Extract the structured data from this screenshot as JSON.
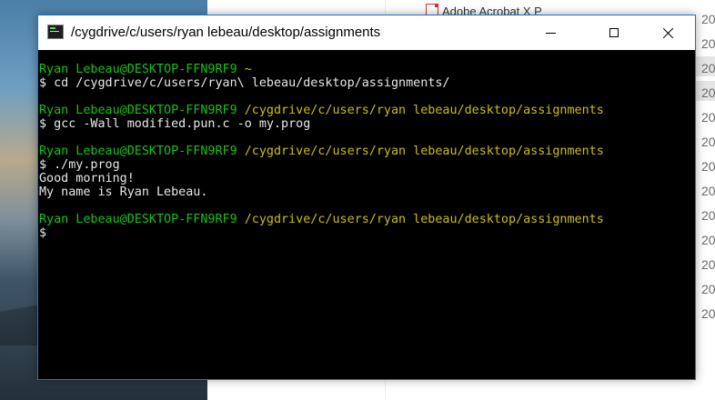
{
  "terminal": {
    "title": "/cygdrive/c/users/ryan lebeau/desktop/assignments",
    "controls": {
      "minimize_icon": "minimize-icon",
      "maximize_icon": "maximize-icon",
      "close_icon": "close-icon"
    },
    "colors": {
      "user_host": "#13c313",
      "path": "#c9c000",
      "text": "#e8e8e8",
      "background": "#000000",
      "border": "#1f72c6"
    },
    "lines": [
      {
        "user_host": "Ryan Lebeau@DESKTOP-FFN9RF9",
        "path": "~"
      },
      {
        "cmd": "$ cd /cygdrive/c/users/ryan\\ lebeau/desktop/assignments/"
      },
      {
        "blank": true
      },
      {
        "user_host": "Ryan Lebeau@DESKTOP-FFN9RF9",
        "path": "/cygdrive/c/users/ryan lebeau/desktop/assignments"
      },
      {
        "cmd": "$ gcc -Wall modified.pun.c -o my.prog"
      },
      {
        "blank": true
      },
      {
        "user_host": "Ryan Lebeau@DESKTOP-FFN9RF9",
        "path": "/cygdrive/c/users/ryan lebeau/desktop/assignments"
      },
      {
        "cmd": "$ ./my.prog"
      },
      {
        "out": "Good morning!"
      },
      {
        "out": "My name is Ryan Lebeau."
      },
      {
        "blank": true
      },
      {
        "user_host": "Ryan Lebeau@DESKTOP-FFN9RF9",
        "path": "/cygdrive/c/users/ryan lebeau/desktop/assignments"
      },
      {
        "cmd": "$"
      }
    ]
  },
  "background_window": {
    "top_file_label": "Adobe Acrobat X P",
    "date_column": [
      "20",
      "20",
      "20",
      "20",
      "20",
      "20",
      "20",
      "20",
      "20",
      "20",
      "20",
      "20",
      "20"
    ]
  }
}
